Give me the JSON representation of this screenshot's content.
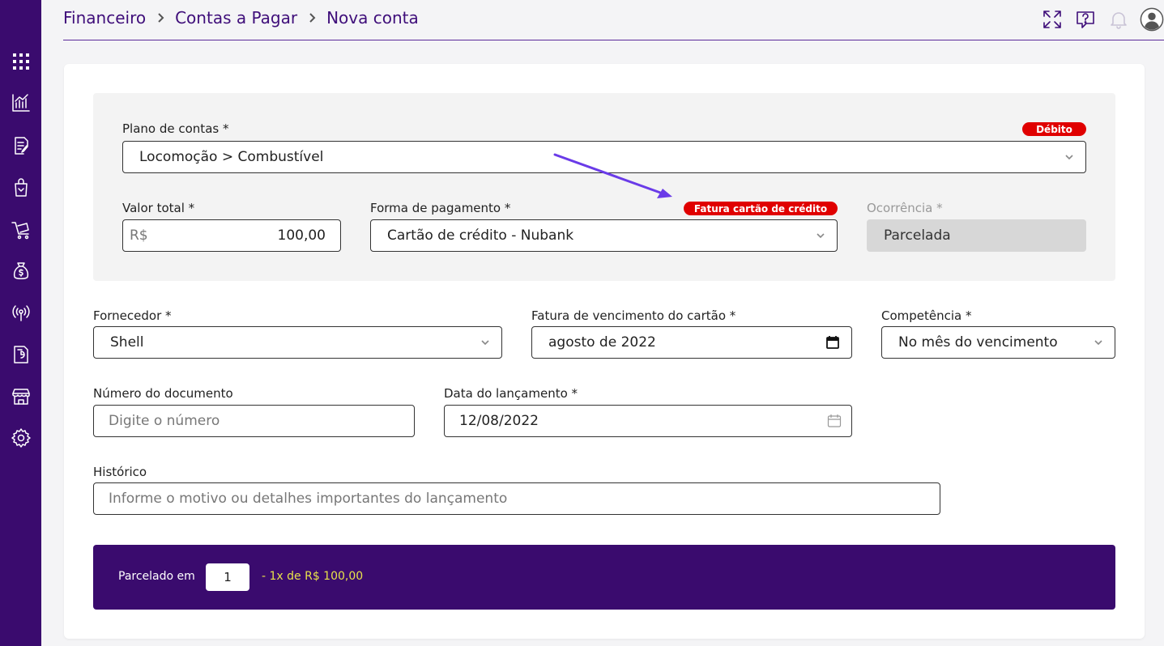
{
  "breadcrumb": {
    "items": [
      "Financeiro",
      "Contas a Pagar",
      "Nova conta"
    ]
  },
  "sidebar": {
    "items": [
      {
        "icon": "grid-icon"
      },
      {
        "icon": "chart-icon"
      },
      {
        "icon": "document-edit-icon"
      },
      {
        "icon": "shopping-bag-icon"
      },
      {
        "icon": "cart-icon"
      },
      {
        "icon": "money-bag-icon"
      },
      {
        "icon": "broadcast-icon"
      },
      {
        "icon": "report-icon"
      },
      {
        "icon": "store-icon"
      },
      {
        "icon": "gear-icon"
      }
    ]
  },
  "top_icons": [
    "fullscreen-icon",
    "help-icon",
    "bell-icon",
    "avatar-icon"
  ],
  "form": {
    "plano_contas": {
      "label": "Plano de contas *",
      "value": "Locomoção > Combustível",
      "badge": "Débito"
    },
    "valor_total": {
      "label": "Valor total *",
      "prefix": "R$",
      "value": "100,00"
    },
    "forma_pagamento": {
      "label": "Forma de pagamento *",
      "value": "Cartão de crédito - Nubank",
      "badge": "Fatura cartão de crédito"
    },
    "ocorrencia": {
      "label": "Ocorrência *",
      "value": "Parcelada"
    },
    "fornecedor": {
      "label": "Fornecedor *",
      "value": "Shell"
    },
    "fatura_vencimento": {
      "label": "Fatura de vencimento do cartão *",
      "value": "agosto de 2022"
    },
    "competencia": {
      "label": "Competência *",
      "value": "No mês do vencimento"
    },
    "numero_documento": {
      "label": "Número do documento",
      "placeholder": "Digite o número"
    },
    "data_lancamento": {
      "label": "Data do lançamento *",
      "value": "12/08/2022"
    },
    "historico": {
      "label": "Histórico",
      "placeholder": "Informe o motivo ou detalhes importantes do lançamento"
    }
  },
  "installments": {
    "label": "Parcelado em",
    "count": "1",
    "summary": "- 1x de R$ 100,00"
  },
  "colors": {
    "sidebar": "#3a0b6e",
    "accent": "#3f0e7a",
    "badge": "#e00000",
    "installment_text": "#e8e34a",
    "arrow": "#6a3be8"
  }
}
